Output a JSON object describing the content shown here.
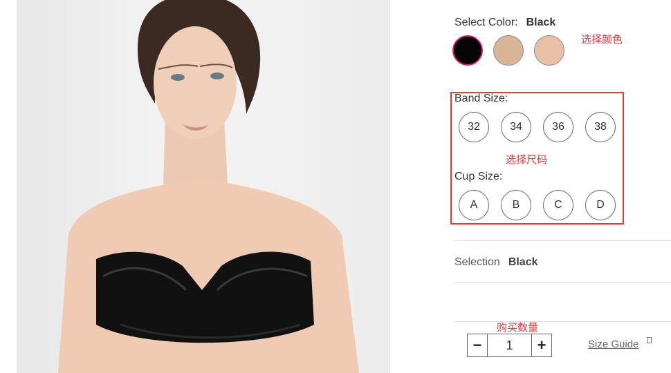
{
  "color": {
    "label": "Select Color:",
    "selected": "Black",
    "swatches": [
      {
        "name": "black",
        "hex": "#050505"
      },
      {
        "name": "nude",
        "hex": "#d8b594"
      },
      {
        "name": "blush",
        "hex": "#e9bfa8"
      }
    ],
    "selected_ring": "#d81e77"
  },
  "annotations": {
    "color": "选择颜色",
    "size": "选择尺码",
    "quantity": "购买数量",
    "accent": "#e53935"
  },
  "band_size": {
    "label": "Band Size:",
    "options": [
      "32",
      "34",
      "36",
      "38"
    ]
  },
  "cup_size": {
    "label": "Cup Size:",
    "options": [
      "A",
      "B",
      "C",
      "D"
    ]
  },
  "selection": {
    "label": "Selection",
    "value": "Black"
  },
  "quantity": {
    "minus": "−",
    "value": "1",
    "plus": "+"
  },
  "size_guide": {
    "label": "Size Guide",
    "icon": "external-link-icon"
  },
  "product_image": {
    "icon": "product-photo"
  }
}
